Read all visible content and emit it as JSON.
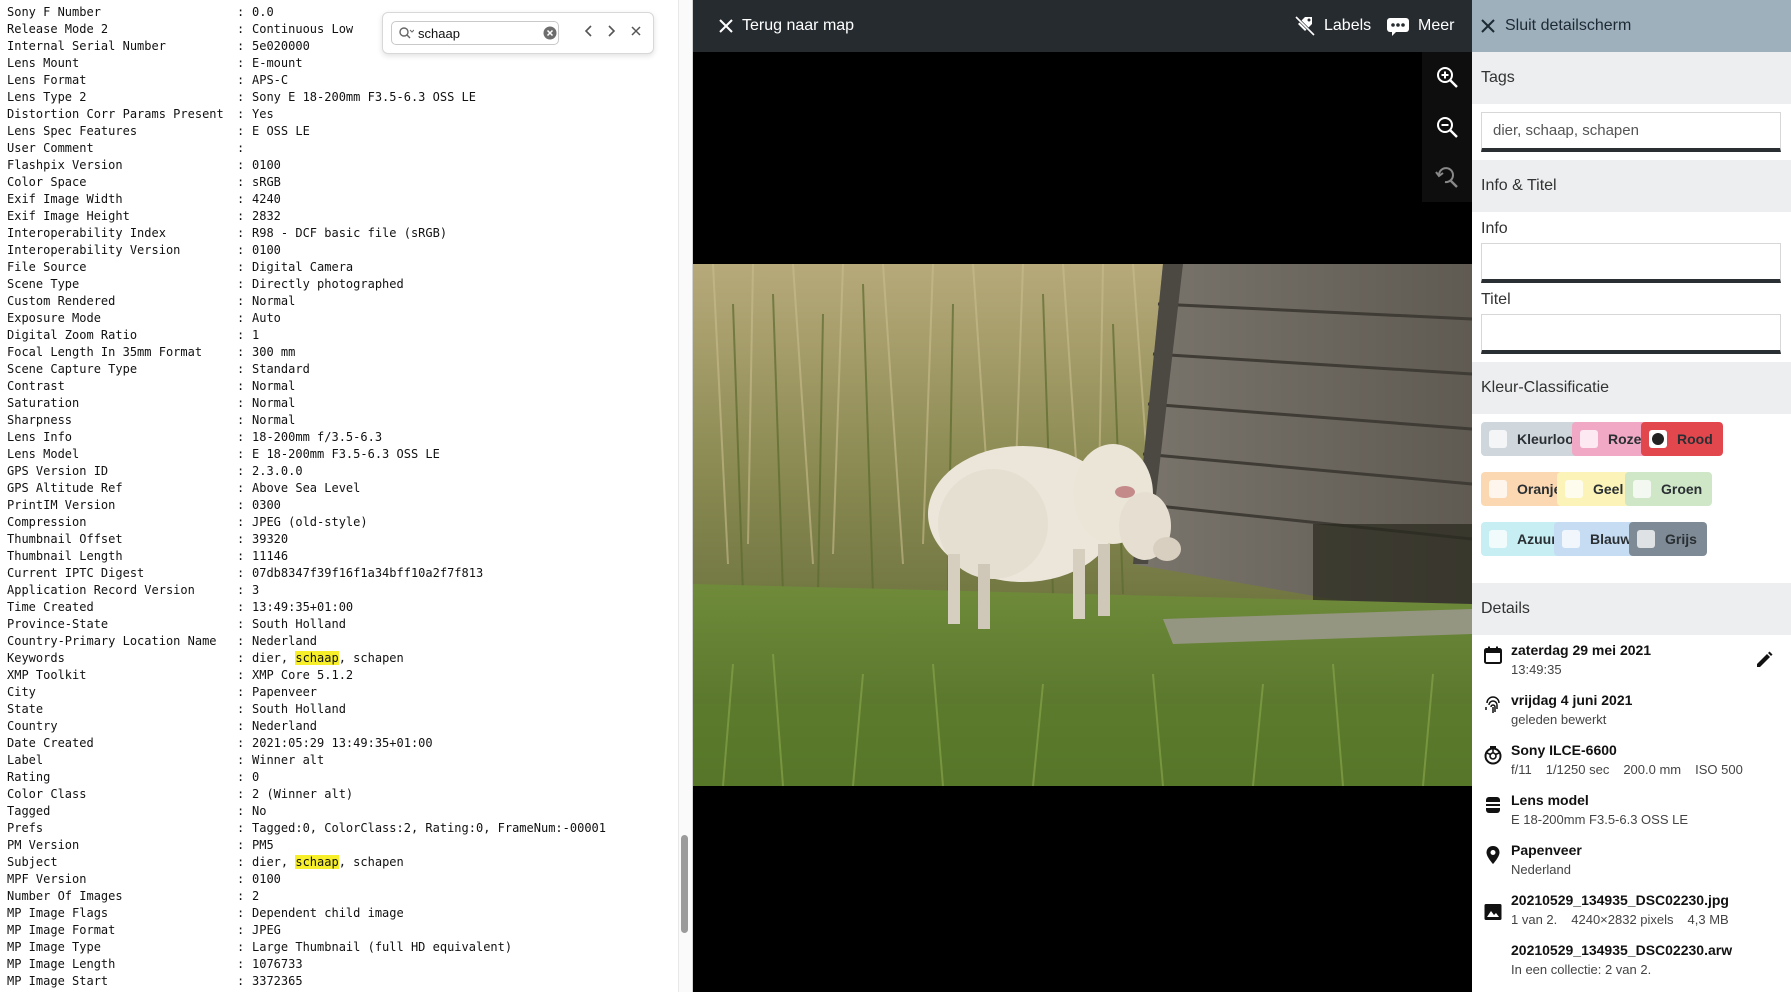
{
  "exif": {
    "rows": [
      {
        "key": "Sony F Number",
        "value": "0.0"
      },
      {
        "key": "Release Mode 2",
        "value": "Continuous Low"
      },
      {
        "key": "Internal Serial Number",
        "value": "5e020000"
      },
      {
        "key": "Lens Mount",
        "value": "E-mount"
      },
      {
        "key": "Lens Format",
        "value": "APS-C"
      },
      {
        "key": "Lens Type 2",
        "value": "Sony E 18-200mm F3.5-6.3 OSS LE"
      },
      {
        "key": "Distortion Corr Params Present",
        "value": "Yes"
      },
      {
        "key": "Lens Spec Features",
        "value": "E OSS LE"
      },
      {
        "key": "User Comment",
        "value": ""
      },
      {
        "key": "Flashpix Version",
        "value": "0100"
      },
      {
        "key": "Color Space",
        "value": "sRGB"
      },
      {
        "key": "Exif Image Width",
        "value": "4240"
      },
      {
        "key": "Exif Image Height",
        "value": "2832"
      },
      {
        "key": "Interoperability Index",
        "value": "R98 - DCF basic file (sRGB)"
      },
      {
        "key": "Interoperability Version",
        "value": "0100"
      },
      {
        "key": "File Source",
        "value": "Digital Camera"
      },
      {
        "key": "Scene Type",
        "value": "Directly photographed"
      },
      {
        "key": "Custom Rendered",
        "value": "Normal"
      },
      {
        "key": "Exposure Mode",
        "value": "Auto"
      },
      {
        "key": "Digital Zoom Ratio",
        "value": "1"
      },
      {
        "key": "Focal Length In 35mm Format",
        "value": "300 mm"
      },
      {
        "key": "Scene Capture Type",
        "value": "Standard"
      },
      {
        "key": "Contrast",
        "value": "Normal"
      },
      {
        "key": "Saturation",
        "value": "Normal"
      },
      {
        "key": "Sharpness",
        "value": "Normal"
      },
      {
        "key": "Lens Info",
        "value": "18-200mm f/3.5-6.3"
      },
      {
        "key": "Lens Model",
        "value": "E 18-200mm F3.5-6.3 OSS LE"
      },
      {
        "key": "GPS Version ID",
        "value": "2.3.0.0"
      },
      {
        "key": "GPS Altitude Ref",
        "value": "Above Sea Level"
      },
      {
        "key": "PrintIM Version",
        "value": "0300"
      },
      {
        "key": "Compression",
        "value": "JPEG (old-style)"
      },
      {
        "key": "Thumbnail Offset",
        "value": "39320"
      },
      {
        "key": "Thumbnail Length",
        "value": "11146"
      },
      {
        "key": "Current IPTC Digest",
        "value": "07db8347f39f16f1a34bff10a2f7f813"
      },
      {
        "key": "Application Record Version",
        "value": "3"
      },
      {
        "key": "Time Created",
        "value": "13:49:35+01:00"
      },
      {
        "key": "Province-State",
        "value": "South Holland"
      },
      {
        "key": "Country-Primary Location Name",
        "value": "Nederland"
      },
      {
        "key": "Keywords",
        "value_parts": [
          "dier, ",
          "schaap",
          ", schapen"
        ]
      },
      {
        "key": "XMP Toolkit",
        "value": "XMP Core 5.1.2"
      },
      {
        "key": "City",
        "value": "Papenveer"
      },
      {
        "key": "State",
        "value": "South Holland"
      },
      {
        "key": "Country",
        "value": "Nederland"
      },
      {
        "key": "Date Created",
        "value": "2021:05:29 13:49:35+01:00"
      },
      {
        "key": "Label",
        "value": "Winner alt"
      },
      {
        "key": "Rating",
        "value": "0"
      },
      {
        "key": "Color Class",
        "value": "2 (Winner alt)"
      },
      {
        "key": "Tagged",
        "value": "No"
      },
      {
        "key": "Prefs",
        "value": "Tagged:0, ColorClass:2, Rating:0, FrameNum:-00001"
      },
      {
        "key": "PM Version",
        "value": "PM5"
      },
      {
        "key": "Subject",
        "value_parts": [
          "dier, ",
          "schaap",
          ", schapen"
        ]
      },
      {
        "key": "MPF Version",
        "value": "0100"
      },
      {
        "key": "Number Of Images",
        "value": "2"
      },
      {
        "key": "MP Image Flags",
        "value": "Dependent child image"
      },
      {
        "key": "MP Image Format",
        "value": "JPEG"
      },
      {
        "key": "MP Image Type",
        "value": "Large Thumbnail (full HD equivalent)"
      },
      {
        "key": "MP Image Length",
        "value": "1076733"
      },
      {
        "key": "MP Image Start",
        "value": "3372365"
      }
    ]
  },
  "find": {
    "query": "schaap"
  },
  "viewer": {
    "back_label": "Terug naar map",
    "labels_label": "Labels",
    "more_label": "Meer"
  },
  "details": {
    "close_label": "Sluit detailscherm",
    "tags_heading": "Tags",
    "tags_value": "dier, schaap, schapen",
    "info_title_heading": "Info & Titel",
    "info_label": "Info",
    "info_value": "",
    "title_label": "Titel",
    "title_value": "",
    "color_heading": "Kleur-Classificatie",
    "colors": [
      {
        "label": "Kleurloos",
        "color": "#cfd6dc",
        "selected": false
      },
      {
        "label": "Roze",
        "color": "#f1a8c5",
        "selected": false
      },
      {
        "label": "Rood",
        "color": "#e2474e",
        "selected": true
      },
      {
        "label": "Oranje",
        "color": "#fbd8b2",
        "selected": false
      },
      {
        "label": "Geel",
        "color": "#fbf3b8",
        "selected": false
      },
      {
        "label": "Groen",
        "color": "#cfe7c7",
        "selected": false
      },
      {
        "label": "Azuur",
        "color": "#c6eef3",
        "selected": false
      },
      {
        "label": "Blauw",
        "color": "#c6dcf3",
        "selected": false
      },
      {
        "label": "Grijs",
        "color": "#7e8b96",
        "selected": false
      }
    ],
    "details_heading": "Details",
    "date": {
      "primary": "zaterdag 29 mei 2021",
      "secondary": "13:49:35"
    },
    "edited": {
      "primary": "vrijdag 4 juni 2021",
      "secondary": "geleden bewerkt"
    },
    "camera": {
      "primary": "Sony ILCE-6600",
      "aperture": "f/11",
      "shutter": "1/1250 sec",
      "focal": "200.0 mm",
      "iso": "ISO 500"
    },
    "lens": {
      "primary": "Lens model",
      "secondary": "E 18-200mm F3.5-6.3 OSS LE"
    },
    "location": {
      "primary": "Papenveer",
      "secondary": "Nederland"
    },
    "file": {
      "primary": "20210529_134935_DSC02230.jpg",
      "index": "1 van 2.",
      "dimensions": "4240×2832 pixels",
      "size": "4,3 MB"
    },
    "raw": {
      "primary": "20210529_134935_DSC02230.arw",
      "secondary": "In een collectie: 2 van 2."
    }
  }
}
